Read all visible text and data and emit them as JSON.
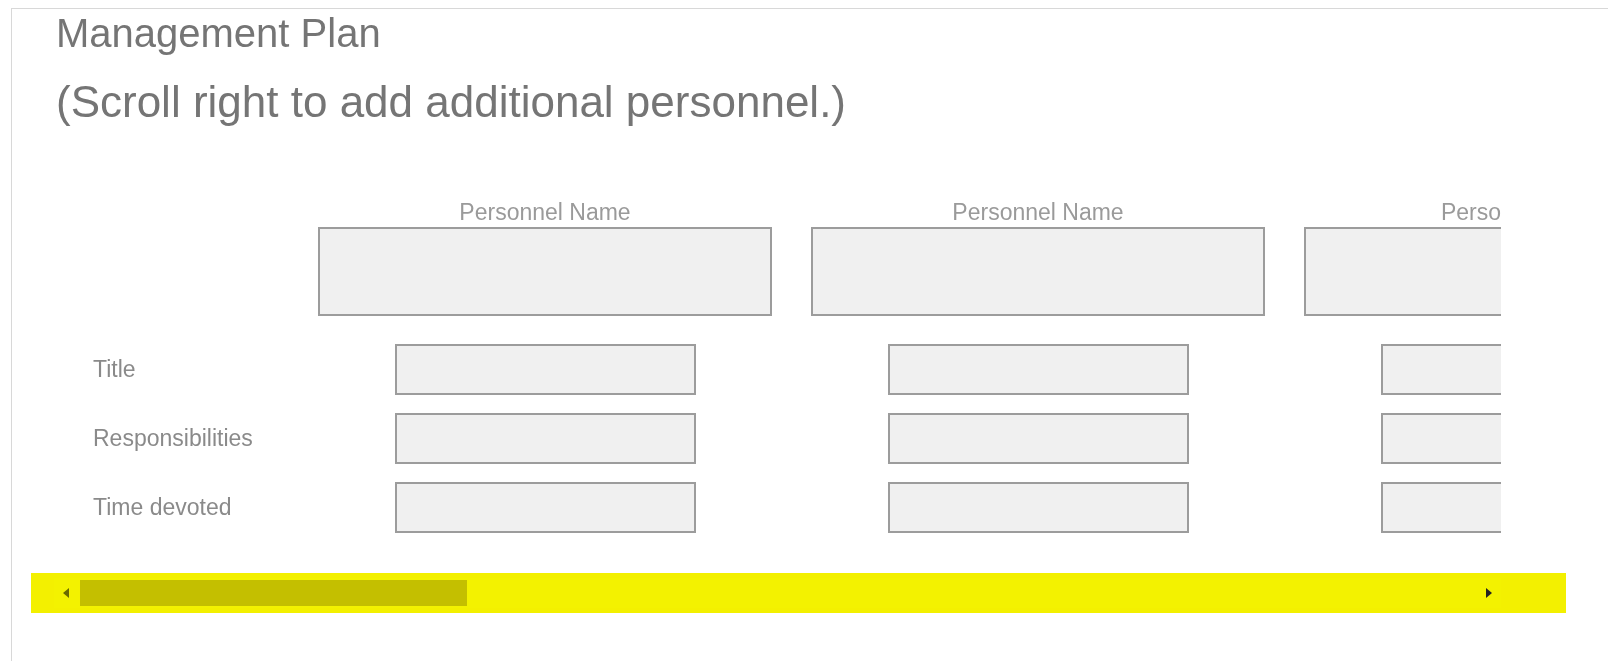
{
  "title": "Management Plan",
  "subtitle": "(Scroll right to add additional personnel.)",
  "row_labels": [
    "Title",
    "Responsibilities",
    "Time devoted"
  ],
  "columns": [
    {
      "header": "Personnel Name"
    },
    {
      "header": "Personnel Name"
    },
    {
      "header": "Perso"
    }
  ]
}
